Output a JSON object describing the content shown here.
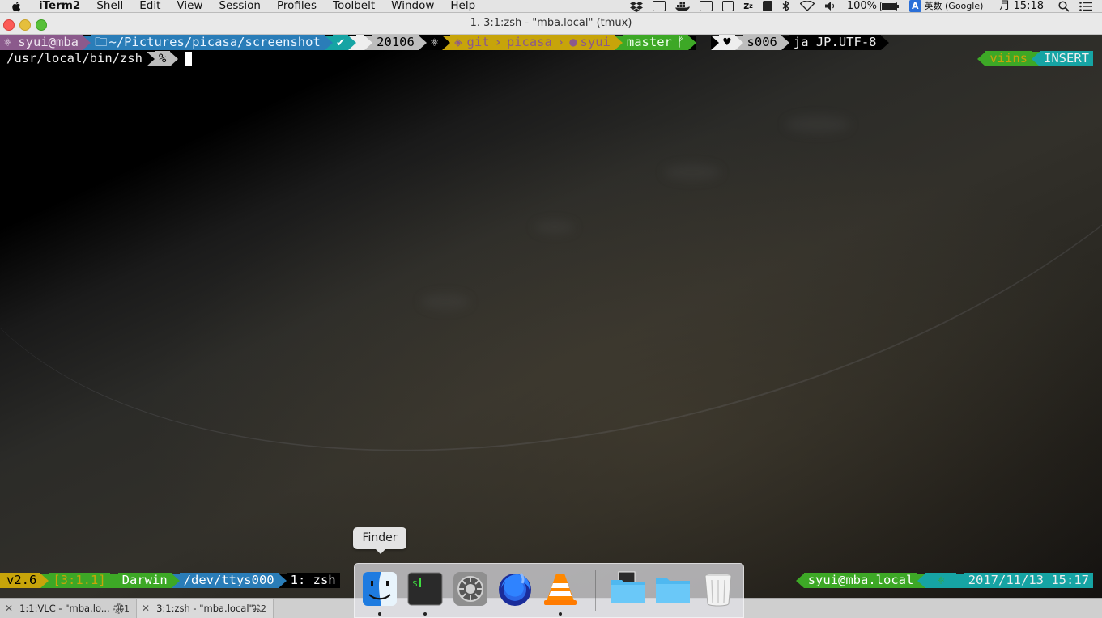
{
  "menubar": {
    "app_name": "iTerm2",
    "items": [
      "Shell",
      "Edit",
      "View",
      "Session",
      "Profiles",
      "Toolbelt",
      "Window",
      "Help"
    ],
    "battery": "100%",
    "input_source_badge": "A",
    "input_source": "英数 (Google)",
    "clock": "月 15:18"
  },
  "window": {
    "title": "1. 3:1:zsh - \"mba.local\"  (tmux)"
  },
  "prompt": {
    "user_host": "syui@mba",
    "path": "~/Pictures/picasa/screenshot",
    "history_num": "20106",
    "vcs_label": "git",
    "repo": "picasa",
    "github_user": "syui",
    "branch": "master",
    "tty": "s006",
    "locale": "ja_JP.UTF-8",
    "shell_path": "/usr/local/bin/zsh",
    "prompt_char": "%",
    "vi_keymap": "viins",
    "vi_mode": "INSERT"
  },
  "tmux": {
    "version": "v2.6",
    "session_index": "[3:1.1]",
    "os": "Darwin",
    "tty": "/dev/ttys000",
    "window": "1: zsh",
    "user_host": "syui@mba.local",
    "datetime": "2017/11/13 15:17"
  },
  "dock": {
    "tooltip": "Finder",
    "items": [
      "Finder",
      "Terminal",
      "System Preferences",
      "Firefox",
      "VLC",
      "Folder",
      "Folder",
      "Trash"
    ]
  },
  "tabs": [
    {
      "label": "1:1:VLC - \"mba.lo...",
      "shortcut": "⌘1"
    },
    {
      "label": "3:1:zsh - \"mba.local\"...",
      "shortcut": "⌘2"
    }
  ],
  "colors": {
    "purple": "#8b5a8c",
    "blue": "#2a7db8",
    "teal": "#16a4a4",
    "yellow": "#c7a40a",
    "green": "#3da826",
    "gray": "#bdbdbd",
    "white": "#eeeeee"
  }
}
